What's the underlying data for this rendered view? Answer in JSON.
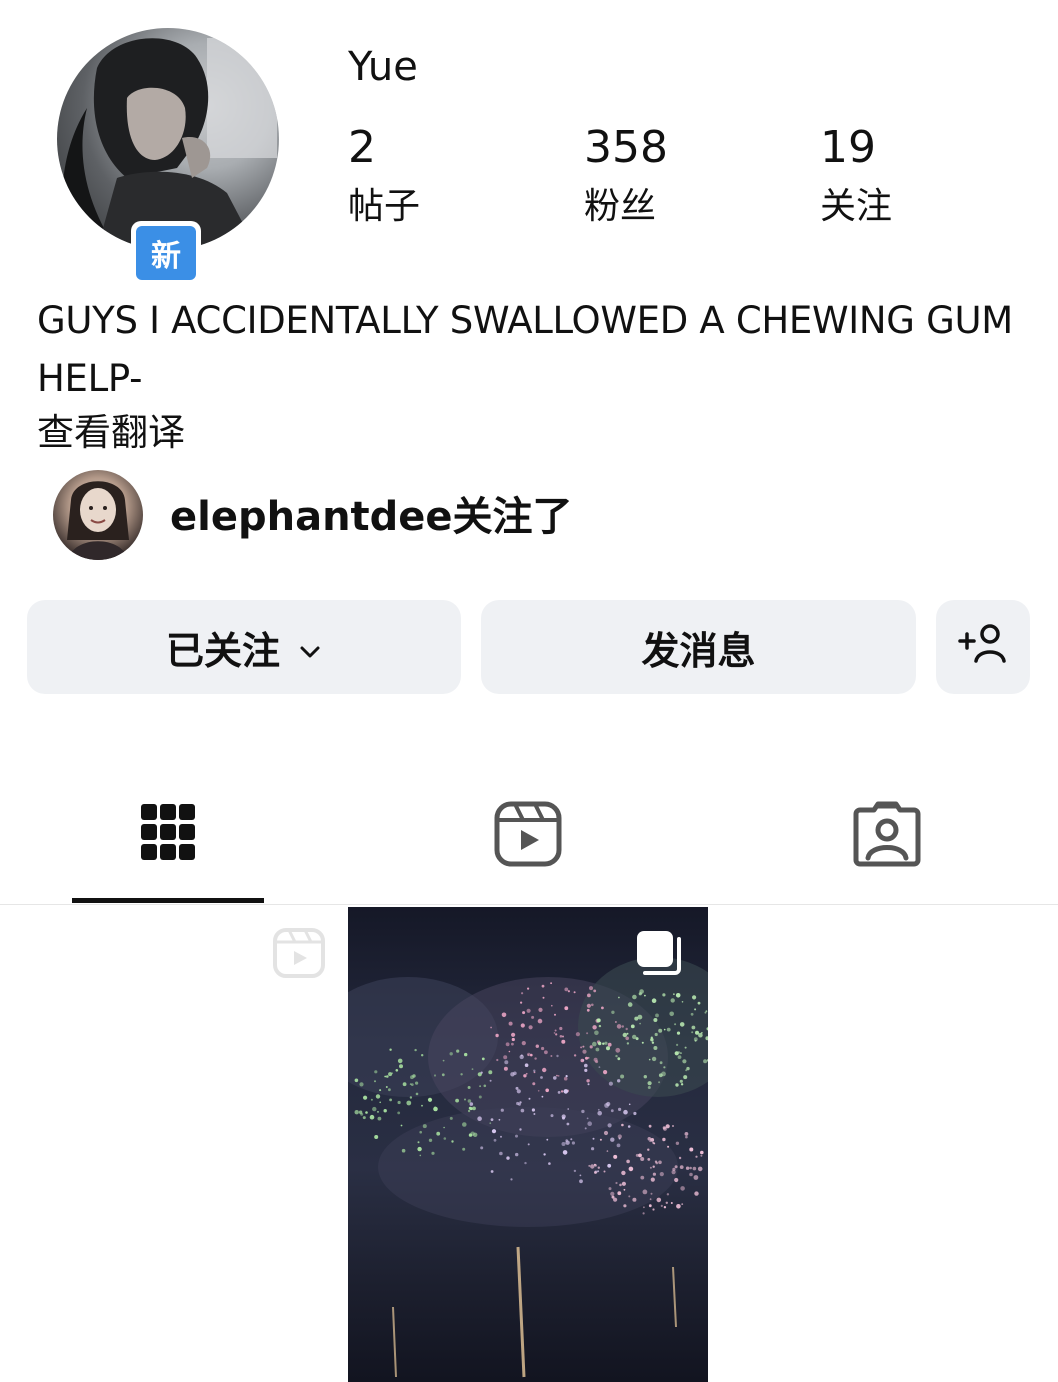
{
  "profile": {
    "username": "Yue",
    "new_badge": "新",
    "avatar_icon": "profile-photo",
    "stats": [
      {
        "count": "2",
        "label": "帖子"
      },
      {
        "count": "358",
        "label": "粉丝"
      },
      {
        "count": "19",
        "label": "关注"
      }
    ],
    "bio": "GUYS I ACCIDENTALLY SWALLOWED A CHEWING GUM HELP-",
    "translate_label": "查看翻译",
    "mutual_follow_text": "elephantdee关注了"
  },
  "actions": {
    "following_label": "已关注",
    "following_icon": "chevron-down-icon",
    "message_label": "发消息",
    "add_person_icon": "add-person-icon"
  },
  "tabs": [
    {
      "icon": "grid-icon",
      "active": true
    },
    {
      "icon": "reels-icon",
      "active": false
    },
    {
      "icon": "tagged-icon",
      "active": false
    }
  ],
  "posts": [
    {
      "type": "reel",
      "icon": "reel-icon"
    },
    {
      "type": "carousel",
      "icon": "carousel-icon",
      "content": "fireworks"
    },
    {
      "type": "empty"
    }
  ],
  "colors": {
    "button_bg": "#eff1f4",
    "badge_blue": "#3b8fe6",
    "text": "#111111"
  }
}
